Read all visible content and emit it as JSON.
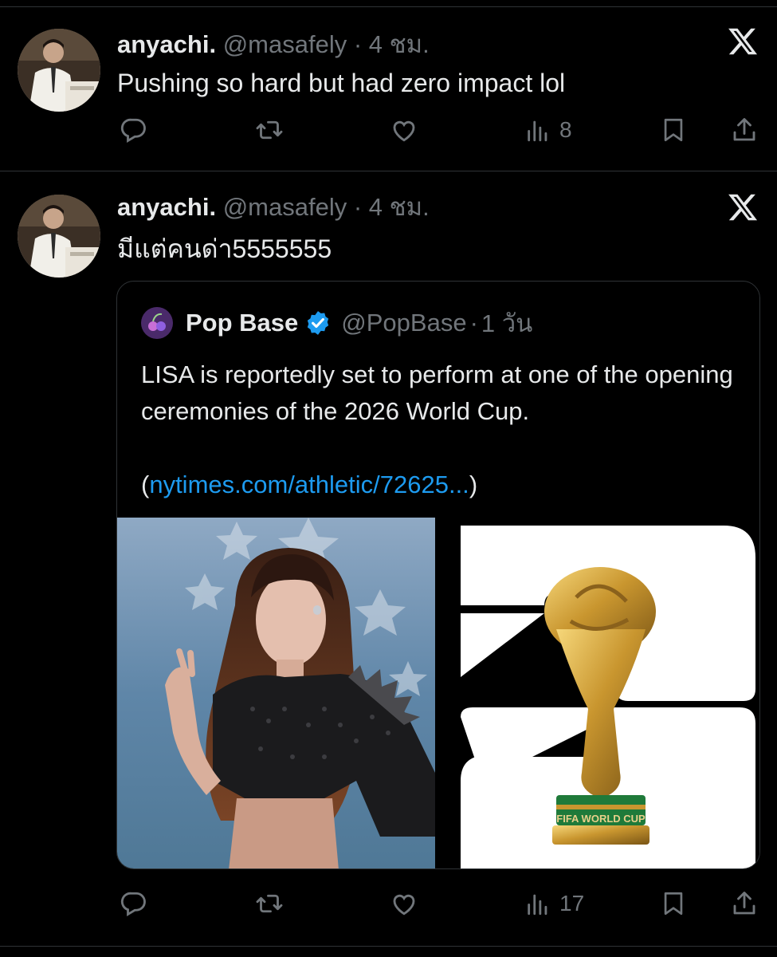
{
  "tweets": [
    {
      "name": "anyachi.",
      "handle": "@masafely",
      "separator": "·",
      "time": "4 ชม.",
      "text": "Pushing so hard but had zero impact lol",
      "views": "8"
    },
    {
      "name": "anyachi.",
      "handle": "@masafely",
      "separator": "·",
      "time": "4 ชม.",
      "text": "มีแต่คนด่า5555555",
      "views": "17",
      "quote": {
        "name": "Pop Base",
        "handle": "@PopBase",
        "separator": "·",
        "time": "1 วัน",
        "text": "LISA is reportedly set to perform at one of the opening ceremonies of the 2026 World Cup.",
        "link_open": "(",
        "link_url": "nytimes.com/athletic/72625...",
        "link_close": ")",
        "trophy_label": "FIFA WORLD CUP"
      }
    }
  ],
  "colors": {
    "background": "#000000",
    "text": "#e7e9ea",
    "muted": "#71767b",
    "link": "#1d9bf0",
    "border": "#2f3336"
  },
  "icons": [
    "x-logo-icon",
    "reply-icon",
    "retweet-icon",
    "like-icon",
    "views-icon",
    "bookmark-icon",
    "share-icon",
    "verified-badge-icon"
  ]
}
